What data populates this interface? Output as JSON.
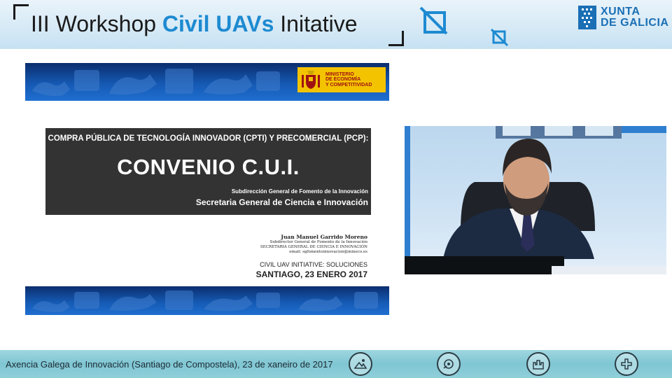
{
  "header": {
    "title_pre": "III Workshop ",
    "title_accent": "Civil UAVs",
    "title_post": " Initative",
    "brand_line1": "XUNTA",
    "brand_line2": "DE GALICIA",
    "accent_color": "#1d8ad1"
  },
  "slide": {
    "ministry_line1": "MINISTERIO",
    "ministry_line2": "DE ECONOMÍA",
    "ministry_line3": "Y COMPETITIVIDAD",
    "cpti_line": "COMPRA PÚBLICA DE TECNOLOGÍA INNOVADOR (CPTI) Y PRECOMERCIAL (PCP):",
    "main_title": "CONVENIO C.U.I.",
    "subdirection": "Subdirección General de Fomento de la Innovación",
    "secretaria": "Secretaria General de Ciencia e Innovación",
    "author_name": "Juan Manuel Garrido Moreno",
    "author_role": "Subdirector General de Fomento de la Innovación",
    "author_org": "SECRETARIA GENERAL DE CIENCIA E INNOVACIÓN",
    "author_email": "email: sgfomentoinnovacion@mineco.es",
    "event_line": "CIVIL UAV INITIATIVE: SOLUCIONES",
    "date_line": "SANTIAGO, 23 ENERO 2017"
  },
  "footer": {
    "caption": "Axencia Galega de Innovación (Santiago de Compostela), 23 de xaneiro de 2017",
    "icons": [
      "landscape-icon",
      "gear-eye-icon",
      "castle-icon",
      "medical-cross-icon"
    ]
  }
}
